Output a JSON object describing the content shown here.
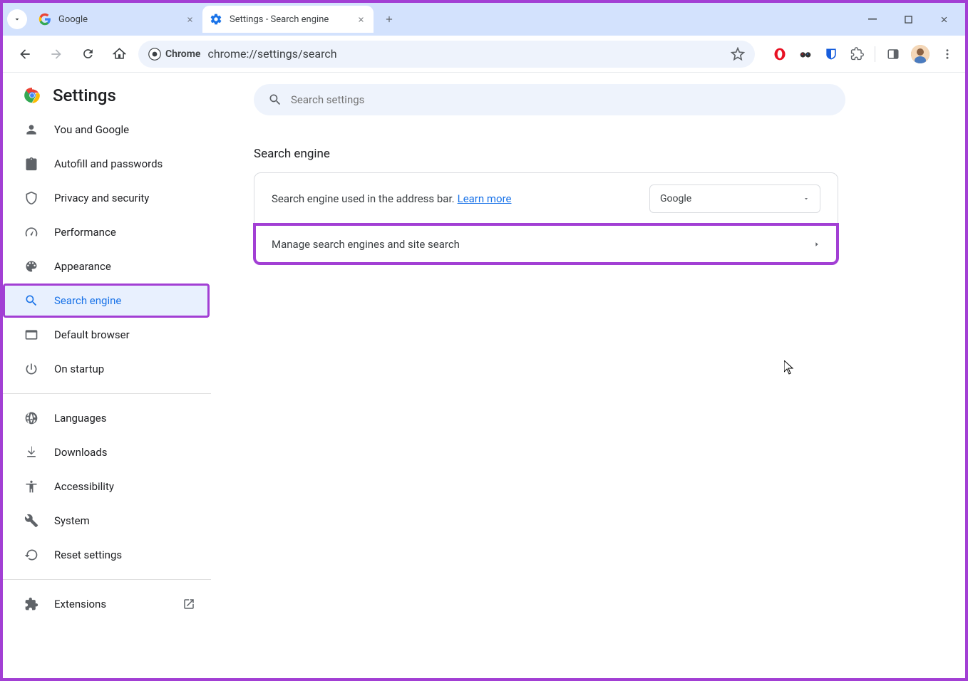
{
  "tabs": [
    {
      "title": "Google"
    },
    {
      "title": "Settings - Search engine"
    }
  ],
  "omnibox": {
    "chip": "Chrome",
    "url": "chrome://settings/search"
  },
  "settings": {
    "title": "Settings",
    "search_placeholder": "Search settings",
    "sidebar": [
      {
        "label": "You and Google"
      },
      {
        "label": "Autofill and passwords"
      },
      {
        "label": "Privacy and security"
      },
      {
        "label": "Performance"
      },
      {
        "label": "Appearance"
      },
      {
        "label": "Search engine"
      },
      {
        "label": "Default browser"
      },
      {
        "label": "On startup"
      },
      {
        "label": "Languages"
      },
      {
        "label": "Downloads"
      },
      {
        "label": "Accessibility"
      },
      {
        "label": "System"
      },
      {
        "label": "Reset settings"
      },
      {
        "label": "Extensions"
      }
    ],
    "section": {
      "heading": "Search engine",
      "row1_text": "Search engine used in the address bar.",
      "row1_learn": "Learn more",
      "row1_select": "Google",
      "row2_text": "Manage search engines and site search"
    }
  }
}
